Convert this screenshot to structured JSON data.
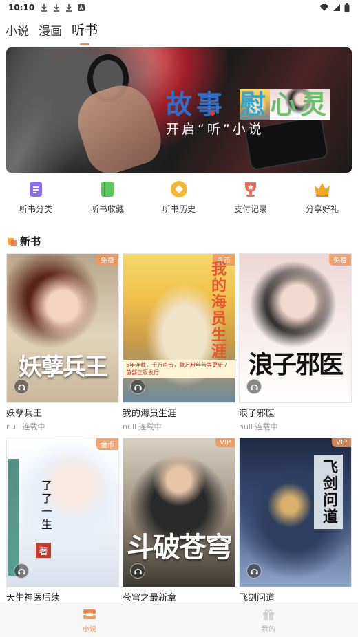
{
  "status_bar": {
    "time": "10:10"
  },
  "top_tabs": [
    {
      "label": "小说",
      "active": false
    },
    {
      "label": "漫画",
      "active": false
    },
    {
      "label": "听书",
      "active": true
    }
  ],
  "banner": {
    "title_1": "故事",
    "title_2": "慰",
    "title_3": "心灵",
    "subtitle": "开启“听”小说"
  },
  "menu": [
    {
      "label": "听书分类",
      "icon": "category-doc-icon",
      "color": "#8b6cf0"
    },
    {
      "label": "听书收藏",
      "icon": "bookmark-book-icon",
      "color": "#5cc75a"
    },
    {
      "label": "听书历史",
      "icon": "history-diamond-icon",
      "color": "#f5b731"
    },
    {
      "label": "支付记录",
      "icon": "trophy-icon",
      "color": "#f26d5b"
    },
    {
      "label": "分享好礼",
      "icon": "crown-icon",
      "color": "#f5a623"
    }
  ],
  "section": {
    "title": "新书"
  },
  "books": [
    {
      "name": "妖孽兵王",
      "status": "null 连载中",
      "badge": "免费",
      "cover_text": "妖孽兵王"
    },
    {
      "name": "我的海员生涯",
      "status": "null 连载中",
      "badge": "金币",
      "cover_text": "我的海员生涯",
      "cover_strip": "5年连载，千万点击，数万粉丝苦等更新 / 首部正版发行"
    },
    {
      "name": "浪子邪医",
      "status": "null 连载中",
      "badge": "免费",
      "cover_text": "浪子邪医"
    },
    {
      "name": "天生神医后续",
      "status": "",
      "badge": "金币",
      "cover_text": "了了一生",
      "cover_mark": "著"
    },
    {
      "name": "苍穹之最新章",
      "status": "",
      "badge": "VIP",
      "cover_text": "斗破苍穹"
    },
    {
      "name": "飞剑问道",
      "status": "",
      "badge": "VIP",
      "cover_text": "飞剑问道"
    }
  ],
  "bottom_nav": [
    {
      "label": "小说",
      "active": true
    },
    {
      "label": "我的",
      "active": false
    }
  ]
}
